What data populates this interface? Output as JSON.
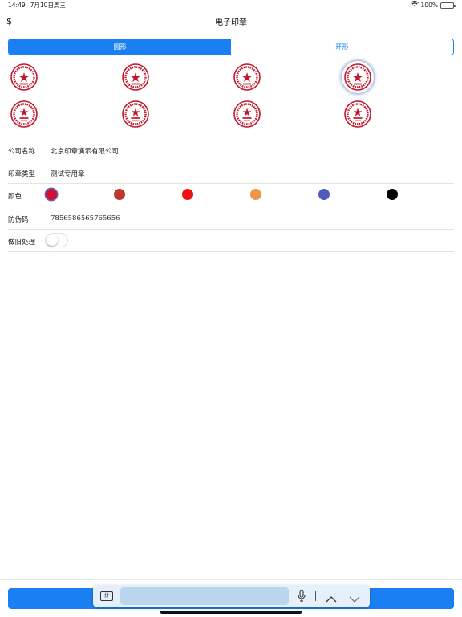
{
  "status_bar": {
    "time": "14:49",
    "date": "7月10日周三",
    "battery_text": "100%"
  },
  "nav": {
    "left_label": "$",
    "title": "电子印章"
  },
  "segments": [
    {
      "label": "圆形",
      "active": true
    },
    {
      "label": "环形",
      "active": false
    }
  ],
  "stamps": [
    {
      "id": "stamp-1",
      "color": "#c4162a",
      "selected": false
    },
    {
      "id": "stamp-2",
      "color": "#c4162a",
      "selected": false
    },
    {
      "id": "stamp-3",
      "color": "#c4162a",
      "selected": false
    },
    {
      "id": "stamp-4",
      "color": "#c4162a",
      "selected": true
    },
    {
      "id": "stamp-5",
      "color": "#c4162a",
      "selected": false
    },
    {
      "id": "stamp-6",
      "color": "#c4162a",
      "selected": false
    },
    {
      "id": "stamp-7",
      "color": "#c4162a",
      "selected": false
    },
    {
      "id": "stamp-8",
      "color": "#c4162a",
      "selected": false
    }
  ],
  "form": {
    "company": {
      "label": "公司名称",
      "value": "北京印章演示有限公司"
    },
    "type": {
      "label": "印章类型",
      "value": "测试专用章"
    },
    "color": {
      "label": "颜色",
      "options": [
        {
          "name": "crimson",
          "hex": "#d2102c",
          "selected": true
        },
        {
          "name": "brick-red",
          "hex": "#c0362c",
          "selected": false
        },
        {
          "name": "red",
          "hex": "#ee1111",
          "selected": false
        },
        {
          "name": "orange",
          "hex": "#ee9548",
          "selected": false
        },
        {
          "name": "blue",
          "hex": "#4d5bbd",
          "selected": false
        },
        {
          "name": "black",
          "hex": "#000000",
          "selected": false
        }
      ]
    },
    "code": {
      "label": "防伪码",
      "value": "7856586565765656"
    },
    "aged": {
      "label": "做旧处理",
      "on": false
    }
  },
  "keyboard_toolbar": {
    "ime_label": "拼"
  },
  "colors": {
    "accent": "#1a7ff0",
    "stamp_red": "#c4162a"
  }
}
